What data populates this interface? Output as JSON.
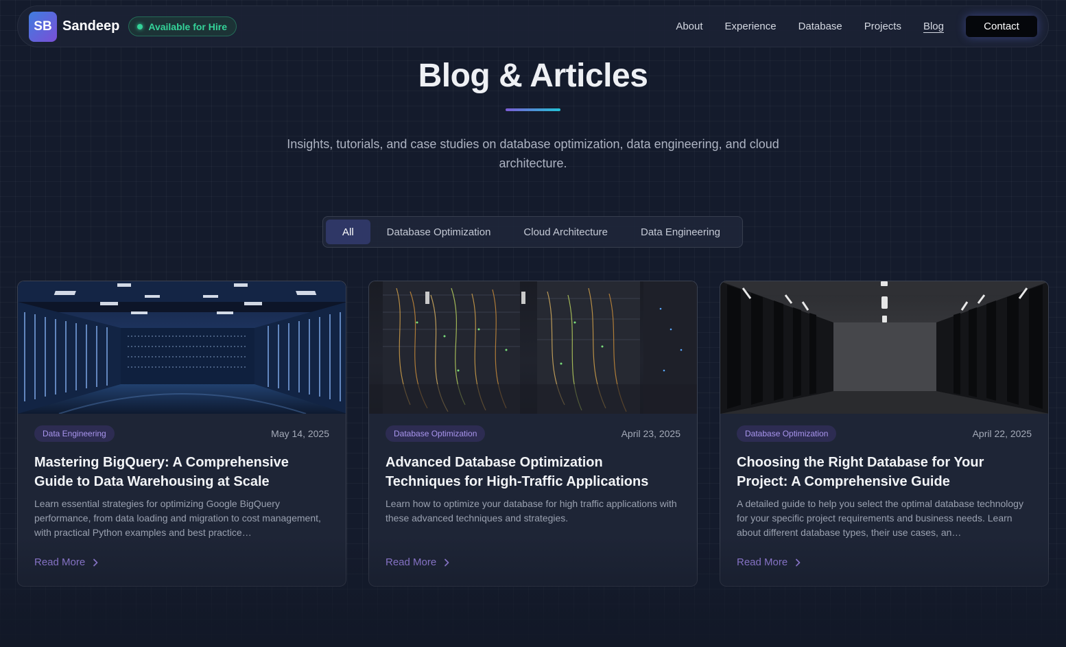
{
  "navbar": {
    "logo_initials": "SB",
    "brand": "Sandeep",
    "hire_badge": "Available for Hire",
    "links": [
      "About",
      "Experience",
      "Database",
      "Projects",
      "Blog"
    ],
    "active_link": "Blog",
    "contact_label": "Contact"
  },
  "header": {
    "title": "Blog & Articles",
    "subtitle": "Insights, tutorials, and case studies on database optimization, data engineering, and cloud architecture."
  },
  "filters": {
    "tabs": [
      "All",
      "Database Optimization",
      "Cloud Architecture",
      "Data Engineering"
    ],
    "active": "All"
  },
  "posts": [
    {
      "category": "Data Engineering",
      "date": "May 14, 2025",
      "title": "Mastering BigQuery: A Comprehensive Guide to Data Warehousing at Scale",
      "excerpt": "Learn essential strategies for optimizing Google BigQuery performance, from data loading and migration to cost management, with practical Python examples and best practice…",
      "read_more": "Read More",
      "image": "data-center-corridor-blue"
    },
    {
      "category": "Database Optimization",
      "date": "April 23, 2025",
      "title": "Advanced Database Optimization Techniques for High-Traffic Applications",
      "excerpt": "Learn how to optimize your database for high traffic applications with these advanced techniques and strategies.",
      "read_more": "Read More",
      "image": "server-rack-cables"
    },
    {
      "category": "Database Optimization",
      "date": "April 22, 2025",
      "title": "Choosing the Right Database for Your Project: A Comprehensive Guide",
      "excerpt": "A detailed guide to help you select the optimal database technology for your specific project requirements and business needs. Learn about different database types, their use cases, an…",
      "read_more": "Read More",
      "image": "server-room-aisle"
    }
  ]
}
